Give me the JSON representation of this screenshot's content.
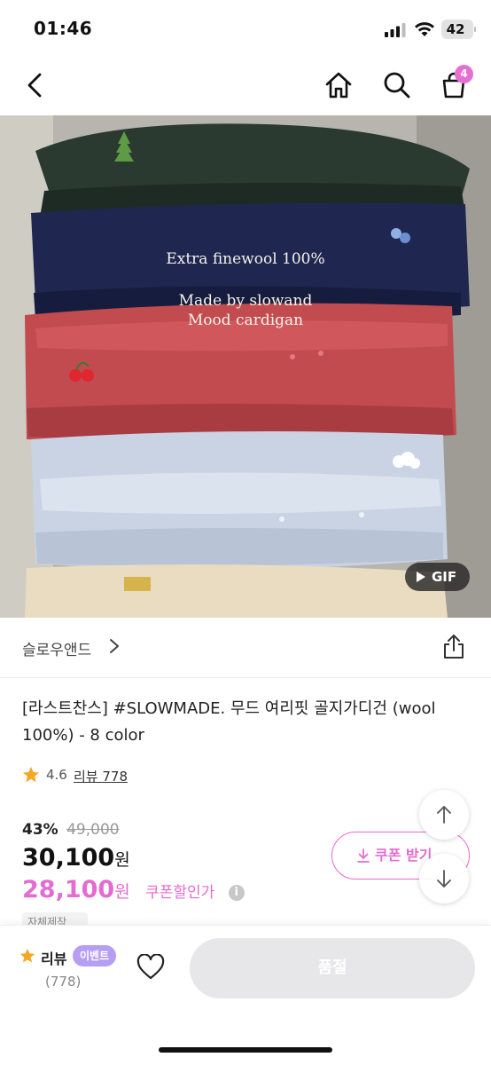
{
  "status_bar": {
    "time": "01:46",
    "battery": "42"
  },
  "header": {
    "back_icon": "chevron-left-icon",
    "home_icon": "home-icon",
    "search_icon": "search-icon",
    "cart_icon": "shopping-bag-icon",
    "cart_count": "4"
  },
  "hero": {
    "overlay_lines": [
      "Extra finewool 100%",
      "Made by slowand",
      "Mood cardigan"
    ],
    "gif_label": "GIF"
  },
  "brand": {
    "name": "슬로우앤드"
  },
  "product": {
    "title": "[라스트찬스] #SLOWMADE. 무드 여리핏 골지가디건 (wool 100%) - 8 color",
    "rating": "4.6",
    "review_link": "리뷰 778",
    "discount_pct": "43%",
    "original_price": "49,000",
    "sale_price": "30,100",
    "currency": "원",
    "coupon_price": "28,100",
    "coupon_label": "쿠폰할인가",
    "coupon_button": "쿠폰 받기",
    "tag": "자체제작"
  },
  "bottom_bar": {
    "review_label": "리뷰",
    "event_badge": "이벤트",
    "review_count": "(778)",
    "soldout_label": "품절"
  },
  "colors": {
    "accent": "#e56bd0",
    "badge": "#e76fd1",
    "event": "#b69ef3",
    "star": "#f5a623"
  }
}
